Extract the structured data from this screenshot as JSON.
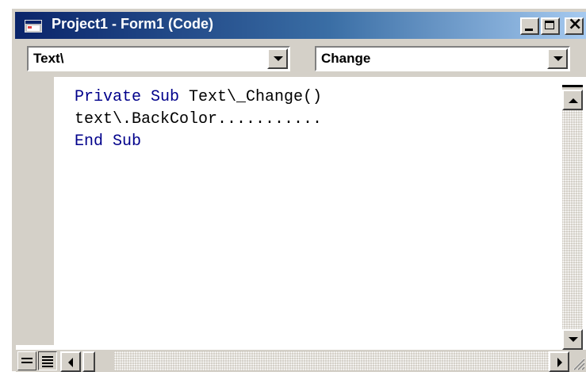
{
  "window": {
    "title": "Project1 - Form1 (Code)",
    "icon": "form-app-icon",
    "buttons": [
      "minimize-icon",
      "maximize-icon",
      "close-icon"
    ],
    "close_label": "×"
  },
  "object_combo": {
    "value": "Text\\"
  },
  "procedure_combo": {
    "value": "Change"
  },
  "code": {
    "line1": {
      "kw": "Private Sub",
      "rest": " Text\\_Change()"
    },
    "line2": "text\\.BackColor...........",
    "line3": {
      "kw": "End Sub"
    }
  },
  "colors": {
    "keyword": "#00008b",
    "titlebar_start": "#0a246a",
    "titlebar_end": "#a6caf0",
    "chrome": "#d4d0c8"
  }
}
